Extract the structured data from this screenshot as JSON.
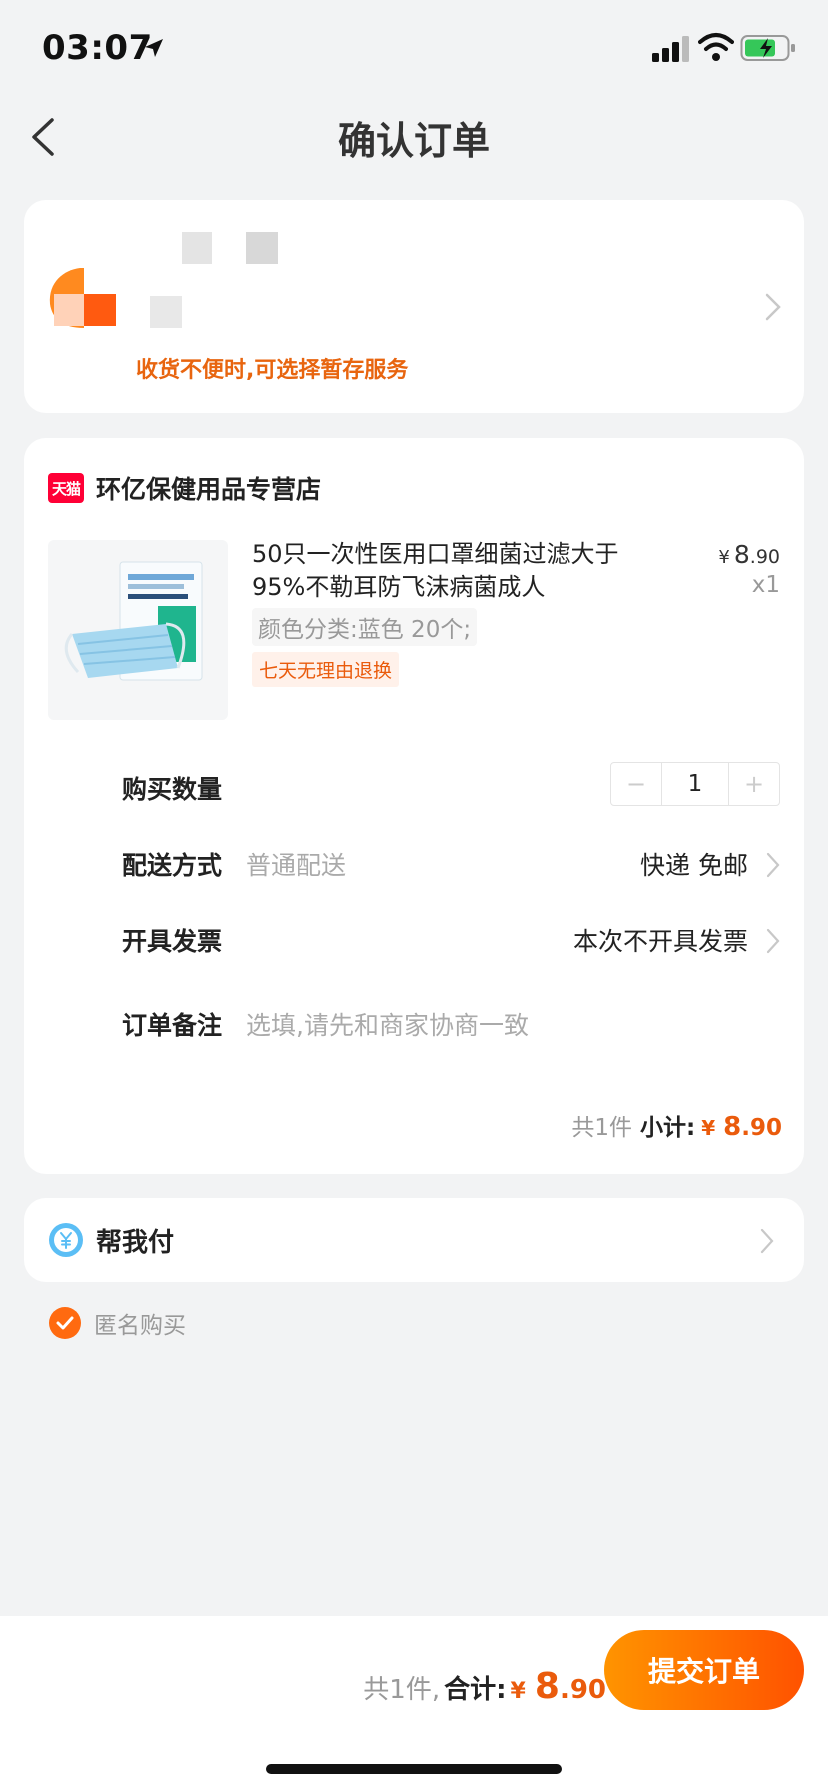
{
  "status_bar": {
    "time": "03:07"
  },
  "nav": {
    "title": "确认订单"
  },
  "address": {
    "tip": "收货不便时,可选择暂存服务"
  },
  "store": {
    "logo_text": "天猫",
    "name": "环亿保健用品专营店"
  },
  "product": {
    "title": "50只一次性医用口罩细菌过滤大于95%不勒耳防飞沫病菌成人",
    "price_currency": "¥",
    "price_int": "8",
    "price_dec": ".90",
    "qty": "x1",
    "sku": "颜色分类:蓝色 20个;",
    "tag": "七天无理由退换"
  },
  "rows": {
    "quantity": {
      "label": "购买数量",
      "minus": "−",
      "value": "1",
      "plus": "+"
    },
    "delivery": {
      "label": "配送方式",
      "hint": "普通配送",
      "value": "快递 免邮"
    },
    "invoice": {
      "label": "开具发票",
      "value": "本次不开具发票"
    },
    "note": {
      "label": "订单备注",
      "placeholder": "选填,请先和商家协商一致"
    }
  },
  "subtotal": {
    "count": "共1件",
    "label": "小计:",
    "currency": "¥",
    "int": "8",
    "dec": ".90"
  },
  "pay_for_me": {
    "label": "帮我付"
  },
  "anonymous": {
    "label": "匿名购买",
    "checked": true
  },
  "bottom": {
    "count": "共1件,",
    "label": "合计:",
    "currency": "¥",
    "int": "8",
    "dec": ".90",
    "submit": "提交订单"
  },
  "colors": {
    "accent": "#ea5b0c",
    "tmall": "#ff0036",
    "button_from": "#ff9400",
    "button_to": "#ff5200"
  }
}
